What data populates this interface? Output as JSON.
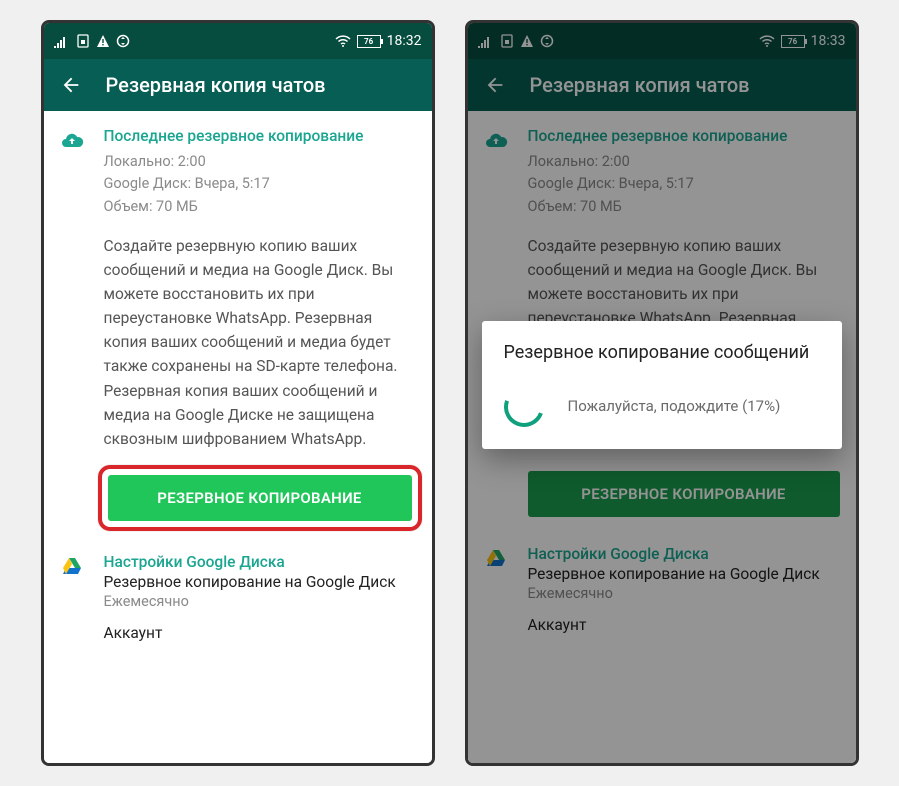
{
  "phones": [
    {
      "status": {
        "time": "18:32",
        "battery": "76"
      },
      "appBar": {
        "title": "Резервная копия чатов"
      },
      "lastBackup": {
        "title": "Последнее резервное копирование",
        "local": "Локально: 2:00",
        "gdrive": "Google Диск: Вчера, 5:17",
        "size": "Объем: 70 МБ"
      },
      "description": "Создайте резервную копию ваших сообщений и медиа на Google Диск. Вы можете восстановить их при переустановке WhatsApp. Резервная копия ваших сообщений и медиа будет также сохранены на SD-карте телефона. Резервная копия ваших сообщений и медиа на Google Диске не защищена сквозным шифрованием WhatsApp.",
      "backupButton": "РЕЗЕРВНОЕ КОПИРОВАНИЕ",
      "gdriveSettings": {
        "title": "Настройки Google Диска",
        "sub": "Резервное копирование на Google Диск",
        "freq": "Ежемесячно",
        "account": "Аккаунт"
      }
    },
    {
      "status": {
        "time": "18:33",
        "battery": "76"
      },
      "appBar": {
        "title": "Резервная копия чатов"
      },
      "lastBackup": {
        "title": "Последнее резервное копирование",
        "local": "Локально: 2:00",
        "gdrive": "Google Диск: Вчера, 5:17",
        "size": "Объем: 70 МБ"
      },
      "description": "Создайте резервную копию ваших сообщений и медиа на Google Диск. Вы можете восстановить их при переустановке WhatsApp. Резервная копия ваших сообщений и медиа будет также сохранены на SD-карте телефона. Резервная копия ваших сообщений и медиа на Google Диске не защищена сквозным шифрованием WhatsApp.",
      "backupButton": "РЕЗЕРВНОЕ КОПИРОВАНИЕ",
      "gdriveSettings": {
        "title": "Настройки Google Диска",
        "sub": "Резервное копирование на Google Диск",
        "freq": "Ежемесячно",
        "account": "Аккаунт"
      },
      "dialog": {
        "title": "Резервное копирование сообщений",
        "wait": "Пожалуйста, подождите (17%)"
      }
    }
  ]
}
